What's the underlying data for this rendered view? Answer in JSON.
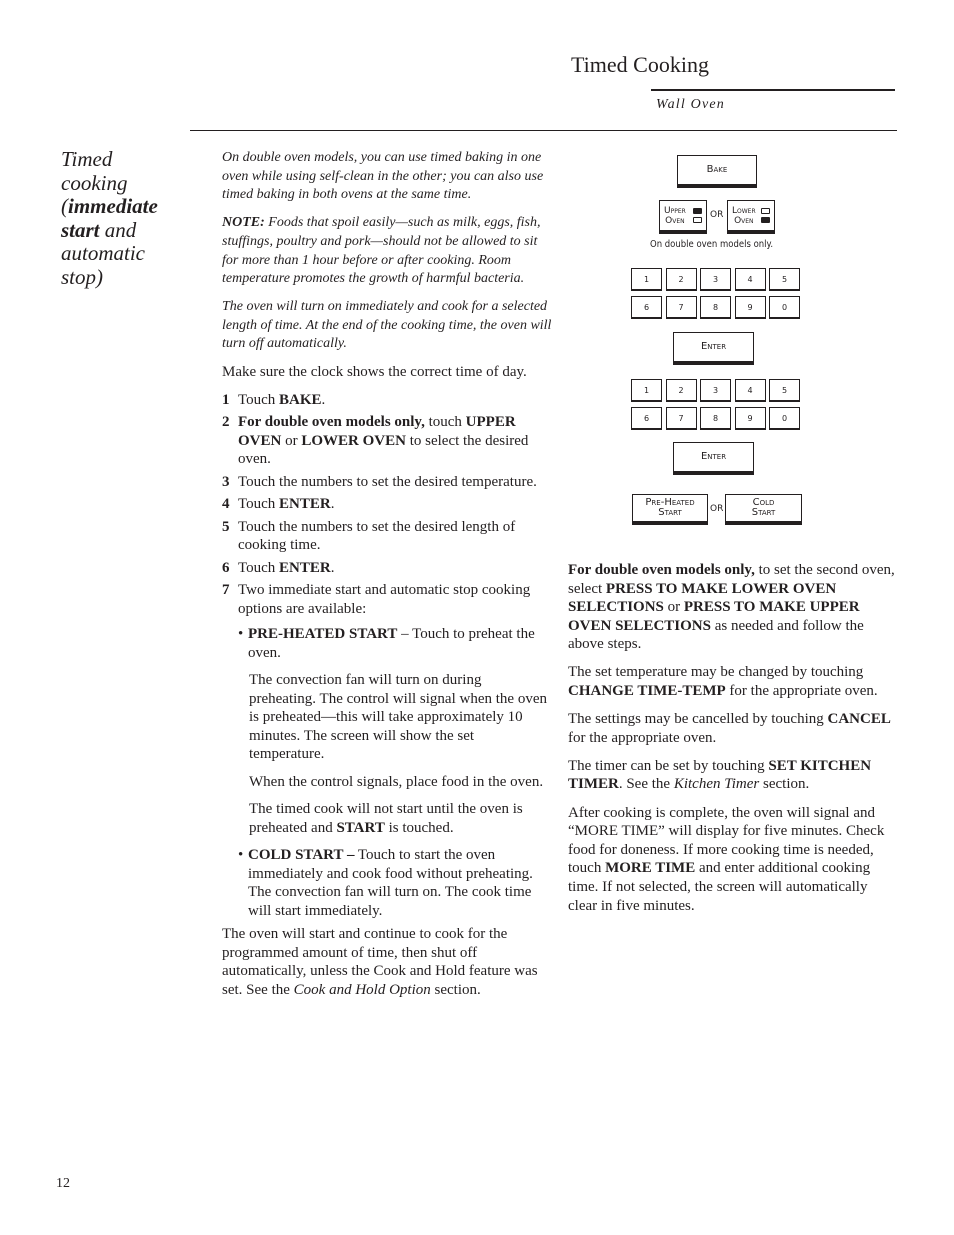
{
  "header": {
    "title": "Timed Cooking",
    "subtitle": "Wall Oven"
  },
  "sidebar": {
    "line1": "Timed",
    "line2": "cooking",
    "line3_prefix": "(",
    "line3_bold": "immediate",
    "line4_bold": "start",
    "line4_rest": " and",
    "line5": "automatic",
    "line6": "stop)"
  },
  "intro": {
    "p1": "On double oven models, you can use timed baking in one oven while using self-clean in the other; you can also use timed baking in both ovens at the same time.",
    "note_label": "NOTE:",
    "note_text": " Foods that spoil easily—such as milk, eggs, fish, stuffings, poultry and pork—should not be allowed to sit for more than 1 hour before or after cooking. Room temperature promotes the growth of harmful bacteria.",
    "p3": "The oven will turn on immediately and cook for a selected length of time. At the end of the cooking time, the oven will turn off automatically.",
    "p4": "Make sure the clock shows the correct time of day."
  },
  "steps": [
    {
      "num": "1",
      "pre": "Touch ",
      "bold": "BAKE",
      "post": "."
    },
    {
      "num": "2",
      "bold1": "For double oven models only,",
      "t1": " touch ",
      "bold2": "UPPER OVEN",
      "t2": " or ",
      "bold3": "LOWER OVEN",
      "t3": " to select the desired oven."
    },
    {
      "num": "3",
      "text": "Touch the numbers to set the desired temperature."
    },
    {
      "num": "4",
      "pre": "Touch ",
      "bold": "ENTER",
      "post": "."
    },
    {
      "num": "5",
      "text": "Touch the numbers to set the desired length of cooking time."
    },
    {
      "num": "6",
      "pre": "Touch ",
      "bold": "ENTER",
      "post": "."
    },
    {
      "num": "7",
      "text": "Two immediate start and automatic stop cooking options are available:"
    }
  ],
  "options": {
    "preheated": {
      "bullet": "•",
      "label": "PRE-HEATED START",
      "text": " – Touch to preheat the oven.",
      "sub1": "The convection fan will turn on during preheating. The control will signal when the oven is preheated—this will take approximately 10 minutes. The screen will show the set temperature.",
      "sub2": "When the control signals, place food in the oven.",
      "sub3_pre": "The timed cook will not start until the oven is preheated and ",
      "sub3_bold": "START",
      "sub3_post": " is touched."
    },
    "cold": {
      "bullet": "•",
      "label": "COLD START –",
      "text": " Touch to start the oven immediately and cook food without preheating. The convection fan will turn on. The cook time will start immediately."
    }
  },
  "closing": {
    "pre": "The oven will start and continue to cook for the programmed amount of time, then shut off automatically, unless the Cook and Hold feature was set. See the ",
    "italic": "Cook and Hold Option",
    "post": " section."
  },
  "diagram": {
    "bake": "Bake",
    "upper_oven": [
      "Upper",
      "Oven"
    ],
    "lower_oven": [
      "Lower",
      "Oven"
    ],
    "or": "OR",
    "caption": "On double oven models only.",
    "keypad_row1": [
      "1",
      "2",
      "3",
      "4",
      "5"
    ],
    "keypad_row2": [
      "6",
      "7",
      "8",
      "9",
      "0"
    ],
    "enter": "Enter",
    "preheated_start": [
      "Pre-Heated",
      "Start"
    ],
    "cold_start": [
      "Cold",
      "Start"
    ]
  },
  "right": {
    "p1_b1": "For double oven models only,",
    "p1_t1": " to set the second oven, select ",
    "p1_b2": "PRESS TO MAKE LOWER OVEN SELECTIONS",
    "p1_t2": " or ",
    "p1_b3": "PRESS TO MAKE UPPER OVEN SELECTIONS",
    "p1_t3": " as needed and follow the above steps.",
    "p2_t1": "The set temperature may be changed by touching ",
    "p2_b": "CHANGE TIME-TEMP",
    "p2_t2": " for the appropriate oven.",
    "p3_t1": "The settings may be cancelled by touching ",
    "p3_b": "CANCEL",
    "p3_t2": " for the appropriate oven.",
    "p4_t1": "The timer can be set by touching ",
    "p4_b": "SET KITCHEN TIMER",
    "p4_t2": ". See the ",
    "p4_i": "Kitchen Timer",
    "p4_t3": " section.",
    "p5_t1": "After cooking is complete, the oven will signal and “MORE TIME” will display for five minutes. Check food for doneness. If more cooking time is needed, touch ",
    "p5_b": "MORE TIME",
    "p5_t2": " and enter additional cooking time. If not selected, the screen will automatically clear in five minutes."
  },
  "footer": {
    "page_number": "12"
  }
}
